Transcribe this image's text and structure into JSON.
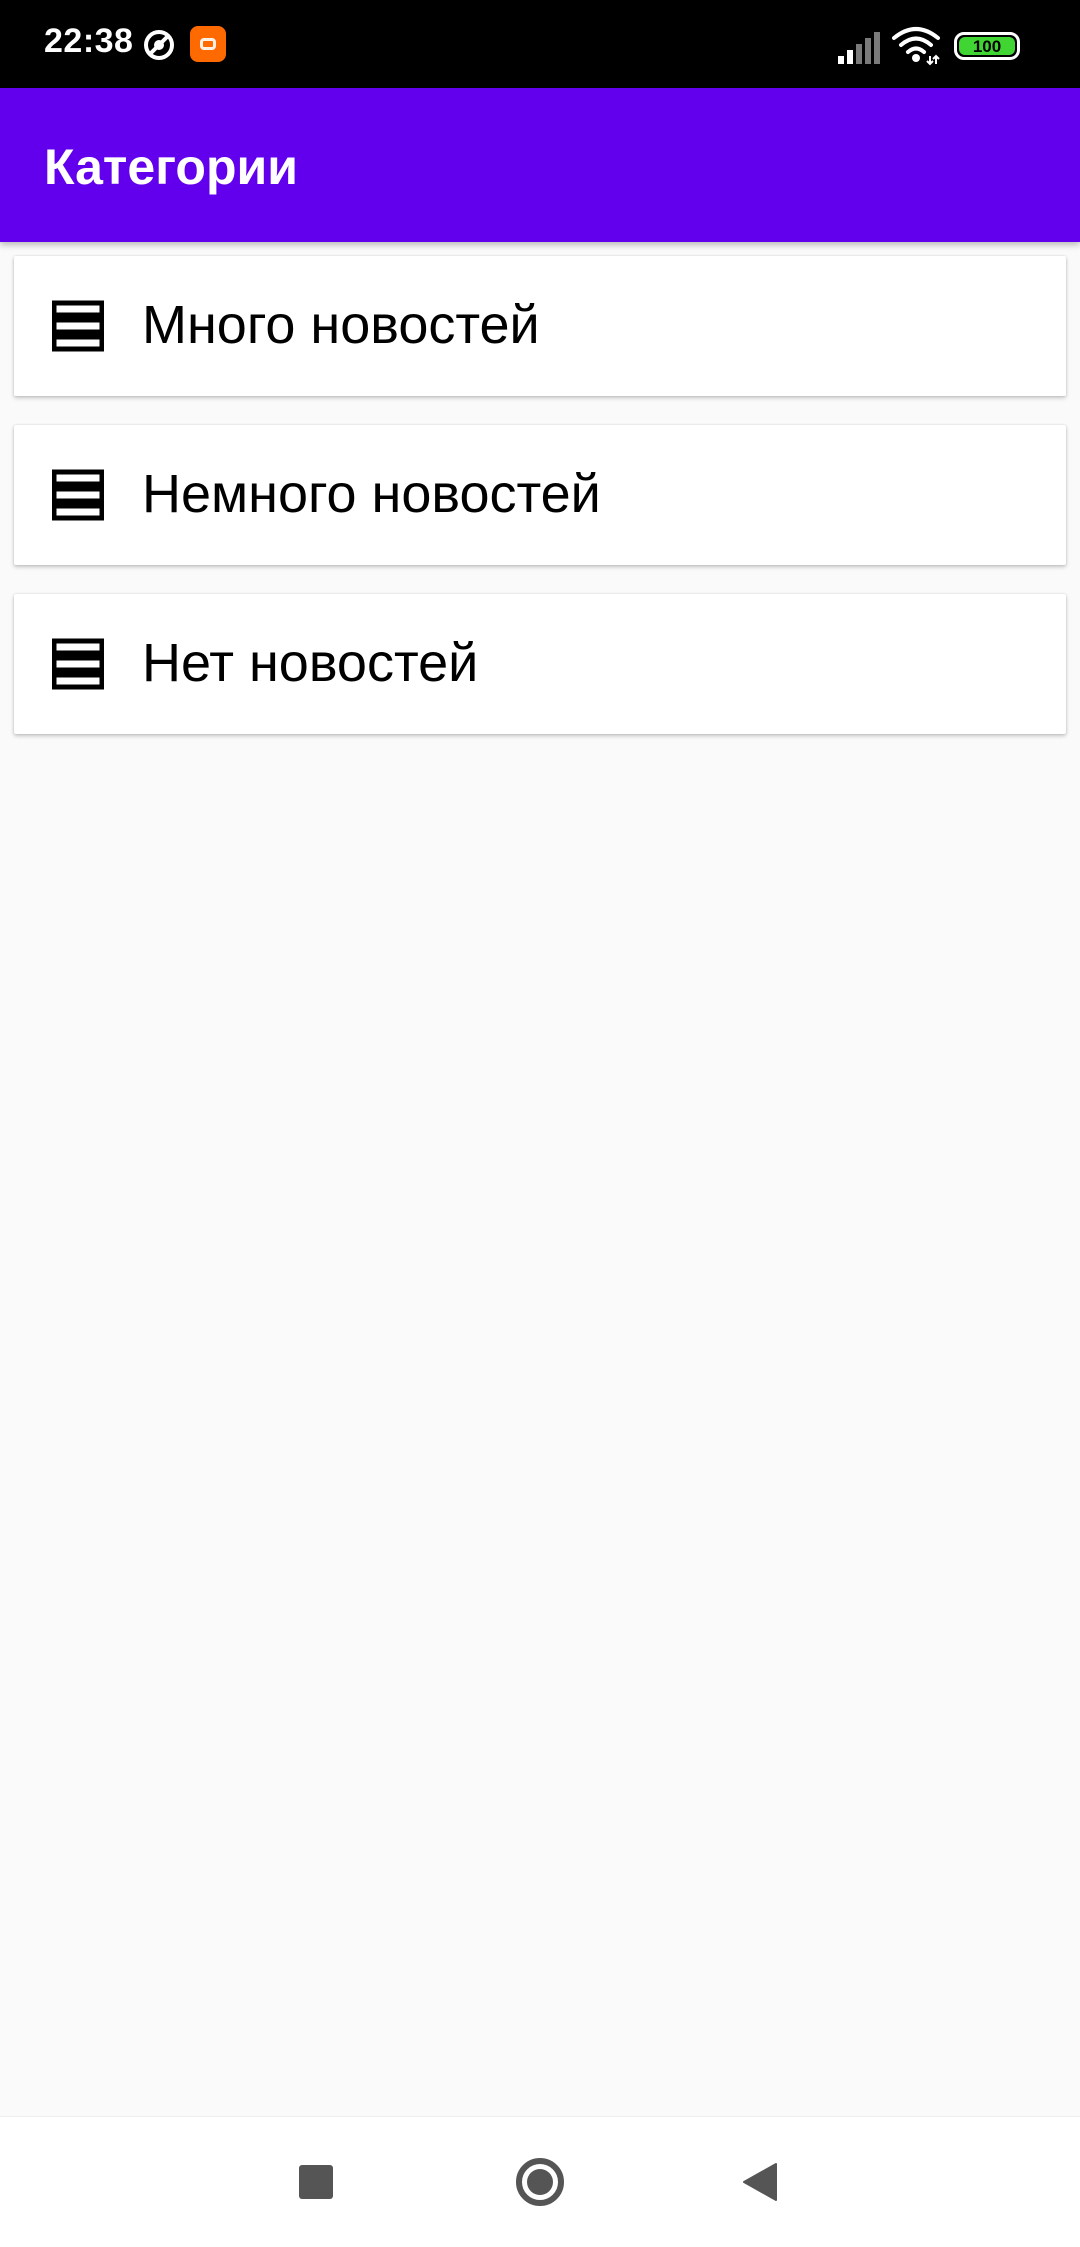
{
  "status_bar": {
    "time": "22:38",
    "battery_level": "100",
    "icons": [
      "do-not-disturb-icon",
      "mi-app-icon",
      "cellular-signal-icon",
      "wifi-icon",
      "battery-icon"
    ],
    "battery_color": "#41d533"
  },
  "app_bar": {
    "title": "Категории",
    "background_color": "#6200ee"
  },
  "categories": [
    {
      "label": "Много новостей",
      "icon": "list-icon"
    },
    {
      "label": "Немного новостей",
      "icon": "list-icon"
    },
    {
      "label": "Нет новостей",
      "icon": "list-icon"
    }
  ],
  "nav_bar": {
    "buttons": [
      "recents-button",
      "home-button",
      "back-button"
    ]
  }
}
